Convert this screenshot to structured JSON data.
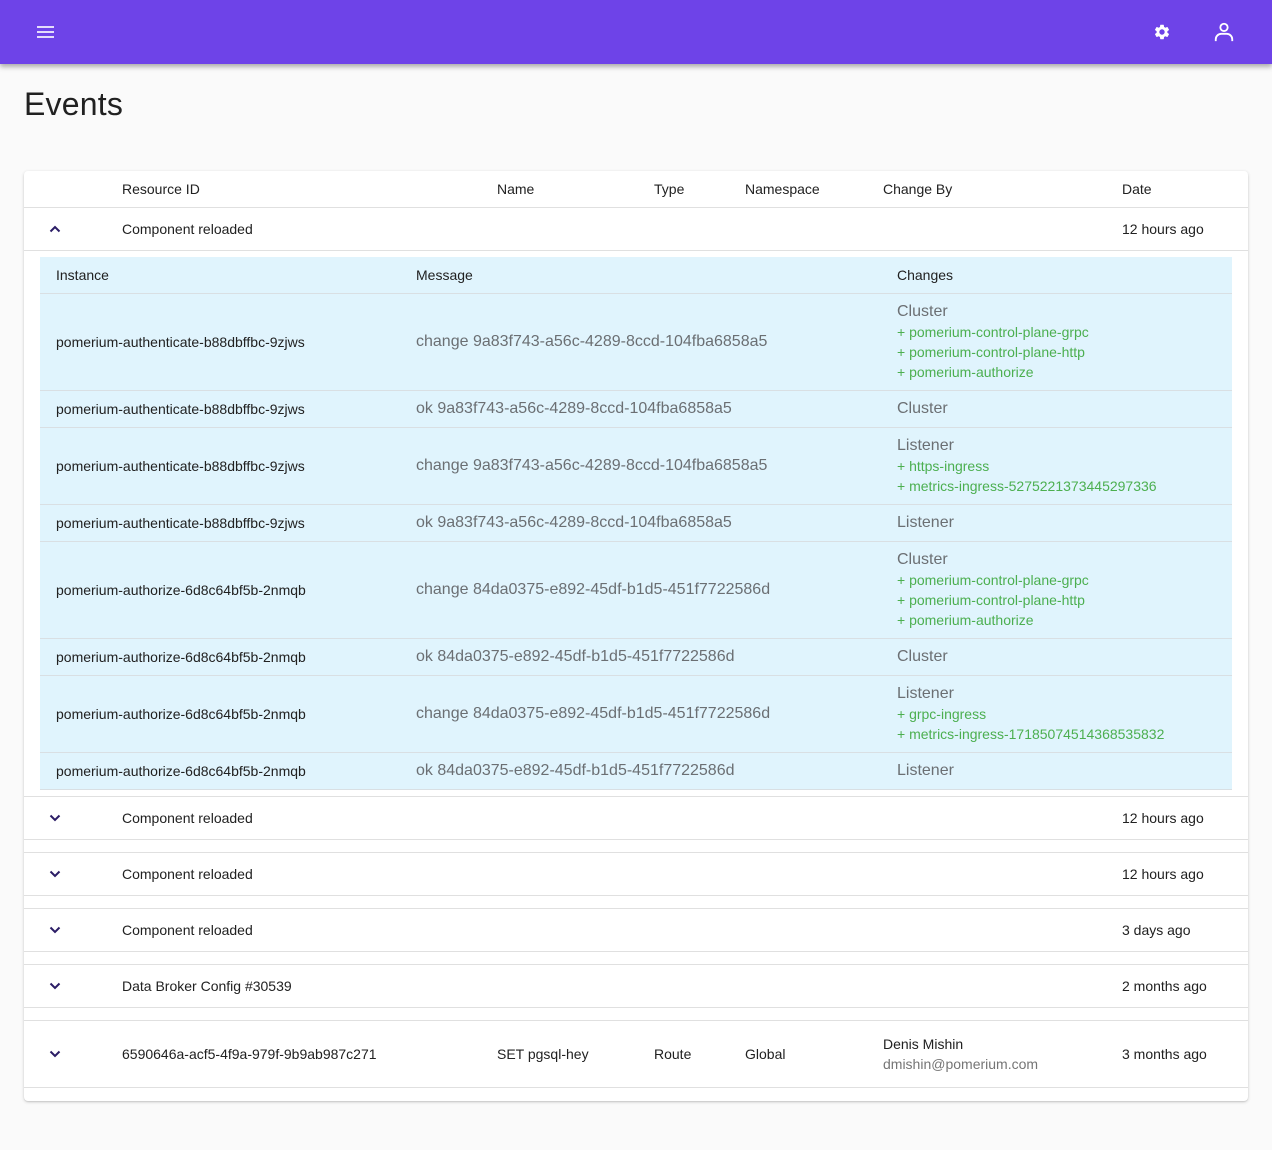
{
  "appbar": {
    "color": "#6e43e8",
    "menu_icon": "menu-icon",
    "settings_icon": "settings-gear-icon",
    "user_icon": "user-account-icon"
  },
  "page": {
    "title": "Events"
  },
  "table": {
    "columns": [
      "Resource ID",
      "Name",
      "Type",
      "Namespace",
      "Change By",
      "Date"
    ],
    "events": [
      {
        "expanded": true,
        "resource_id": "Component reloaded",
        "name": "",
        "type": "",
        "namespace": "",
        "change_by_name": "",
        "change_by_email": "",
        "date": "12 hours ago",
        "details": {
          "columns": [
            "Instance",
            "Message",
            "Changes"
          ],
          "rows": [
            {
              "instance": "pomerium-authenticate-b88dbffbc-9zjws",
              "message": "change 9a83f743-a56c-4289-8ccd-104fba6858a5",
              "kind": "Cluster",
              "items": [
                "+ pomerium-control-plane-grpc",
                "+ pomerium-control-plane-http",
                "+ pomerium-authorize"
              ]
            },
            {
              "instance": "pomerium-authenticate-b88dbffbc-9zjws",
              "message": "ok 9a83f743-a56c-4289-8ccd-104fba6858a5",
              "kind": "Cluster",
              "items": []
            },
            {
              "instance": "pomerium-authenticate-b88dbffbc-9zjws",
              "message": "change 9a83f743-a56c-4289-8ccd-104fba6858a5",
              "kind": "Listener",
              "items": [
                "+ https-ingress",
                "+ metrics-ingress-5275221373445297336"
              ]
            },
            {
              "instance": "pomerium-authenticate-b88dbffbc-9zjws",
              "message": "ok 9a83f743-a56c-4289-8ccd-104fba6858a5",
              "kind": "Listener",
              "items": []
            },
            {
              "instance": "pomerium-authorize-6d8c64bf5b-2nmqb",
              "message": "change 84da0375-e892-45df-b1d5-451f7722586d",
              "kind": "Cluster",
              "items": [
                "+ pomerium-control-plane-grpc",
                "+ pomerium-control-plane-http",
                "+ pomerium-authorize"
              ]
            },
            {
              "instance": "pomerium-authorize-6d8c64bf5b-2nmqb",
              "message": "ok 84da0375-e892-45df-b1d5-451f7722586d",
              "kind": "Cluster",
              "items": []
            },
            {
              "instance": "pomerium-authorize-6d8c64bf5b-2nmqb",
              "message": "change 84da0375-e892-45df-b1d5-451f7722586d",
              "kind": "Listener",
              "items": [
                "+ grpc-ingress",
                "+ metrics-ingress-17185074514368535832"
              ]
            },
            {
              "instance": "pomerium-authorize-6d8c64bf5b-2nmqb",
              "message": "ok 84da0375-e892-45df-b1d5-451f7722586d",
              "kind": "Listener",
              "items": []
            }
          ]
        }
      },
      {
        "expanded": false,
        "resource_id": "Component reloaded",
        "name": "",
        "type": "",
        "namespace": "",
        "change_by_name": "",
        "change_by_email": "",
        "date": "12 hours ago"
      },
      {
        "expanded": false,
        "resource_id": "Component reloaded",
        "name": "",
        "type": "",
        "namespace": "",
        "change_by_name": "",
        "change_by_email": "",
        "date": "12 hours ago"
      },
      {
        "expanded": false,
        "resource_id": "Component reloaded",
        "name": "",
        "type": "",
        "namespace": "",
        "change_by_name": "",
        "change_by_email": "",
        "date": "3 days ago"
      },
      {
        "expanded": false,
        "resource_id": "Data Broker Config #30539",
        "name": "",
        "type": "",
        "namespace": "",
        "change_by_name": "",
        "change_by_email": "",
        "date": "2 months ago"
      },
      {
        "expanded": false,
        "resource_id": "6590646a-acf5-4f9a-979f-9b9ab987c271",
        "name": "SET pgsql-hey",
        "type": "Route",
        "namespace": "Global",
        "change_by_name": "Denis Mishin",
        "change_by_email": "dmishin@pomerium.com",
        "date": "3 months ago"
      }
    ]
  },
  "colors": {
    "primary": "#6e43e8",
    "detail_background": "#e0f4fd",
    "added_item": "#4caf50",
    "chevron": "#2b1d66"
  }
}
